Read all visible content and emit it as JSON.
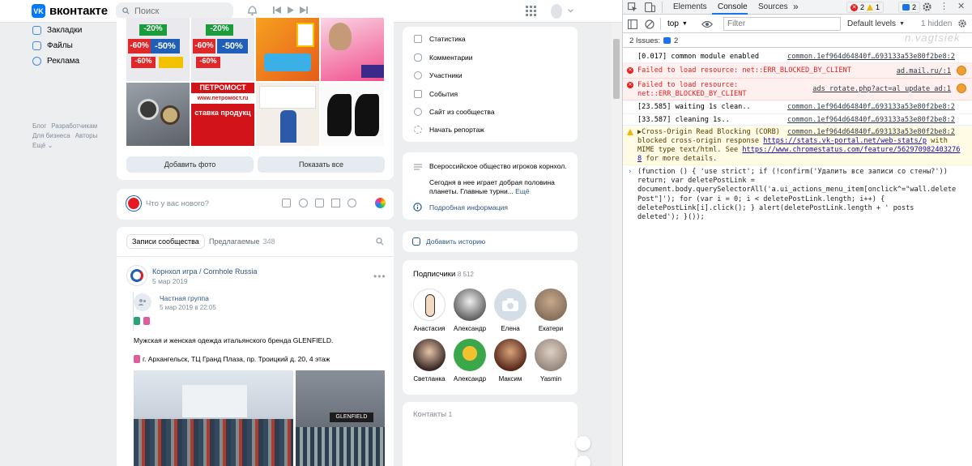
{
  "vk": {
    "logo_text": "вконтакте",
    "logo_mark": "VK",
    "search_placeholder": "Поиск",
    "nav": [
      "Закладки",
      "Файлы",
      "Реклама"
    ],
    "footer": [
      "Блог",
      "Разработчикам",
      "Для бизнеса",
      "Авторы",
      "Ещё ⌄"
    ],
    "photo_tiles": {
      "sale": [
        "-20%",
        "-50%",
        "-60%"
      ],
      "store_sign": "ПЕТРОМОСТ",
      "store_banner": "ставка продукц",
      "store_url": "www.петромост.ru"
    },
    "photo_buttons": [
      "Добавить фото",
      "Показать все"
    ],
    "composer_placeholder": "Что у вас нового?",
    "feed_tabs": {
      "active": "Записи сообщества",
      "suggested": "Предлагаемые",
      "suggested_count": "348"
    },
    "post": {
      "author": "Корнхол игра / Cornhole Russia",
      "date": "5 мар 2019",
      "repost_author": "Частная группа",
      "repost_date": "5 мар 2019 в 22:05",
      "text1": "Мужская и женская одежда итальянского бренда GLENFIELD.",
      "text2": "г. Архангельск, ТЦ Гранд Плаза, пр. Троицкий д. 20, 4 этаж",
      "shop_sign": "GLENFIELD"
    },
    "menu": [
      "Статистика",
      "Комментарии",
      "Участники",
      "События",
      "Сайт из сообщества",
      "Начать репортаж"
    ],
    "info": {
      "title": "Всероссийское общество игроков корнхол.",
      "text": "Сегодня в нее играет добрая половина планеты. Главные турни...",
      "more": "Ещё",
      "details": "Подробная информация"
    },
    "story": "Добавить историю",
    "subscribers": {
      "title": "Подписчики",
      "count": "8 512",
      "people": [
        "Анастасия",
        "Александр",
        "Елена",
        "Екатери",
        "Светланка",
        "Александр",
        "Максим",
        "Yasmin"
      ]
    },
    "contacts": {
      "title": "Контакты",
      "count": "1"
    }
  },
  "devtools": {
    "tabs": [
      "Elements",
      "Console",
      "Sources"
    ],
    "more_tabs": "»",
    "errors_count": "2",
    "warnings_count": "1",
    "issues_count_badge": "2",
    "context": "top",
    "filter_placeholder": "Filter",
    "levels": "Default levels",
    "hidden": "1 hidden",
    "issues_label": "2 Issues:",
    "issues_count": "2",
    "watermark": "n.vagtsiek",
    "logs": [
      {
        "type": "info",
        "text": "[0.017]  common module enabled",
        "src": "common.1ef964d64840f…693133a53e80f2be8:2"
      },
      {
        "type": "error",
        "text": "Failed to load resource: net::ERR_BLOCKED_BY_CLIENT",
        "src": "ad.mail.ru/:1"
      },
      {
        "type": "error",
        "text": "Failed to load resource: net::ERR_BLOCKED_BY_CLIENT",
        "src": "ads_rotate.php?act=al_update_ad:1"
      },
      {
        "type": "info",
        "text": "[23.585]  waiting 1s clean..",
        "src": "common.1ef964d64840f…693133a53e80f2be8:2"
      },
      {
        "type": "info",
        "text": "[33.587]  cleaning 1s..",
        "src": "common.1ef964d64840f…693133a53e80f2be8:2"
      }
    ],
    "corb": {
      "line1": "▶Cross-Origin Read Blocking (CORB)",
      "line2a": "blocked cross-origin response ",
      "line2b": "https://stats.vk-portal.net/web-stats/p",
      "line2c": " with",
      "line3a": "MIME type text/html. See ",
      "line3b": "https://www.chromestatus.com/feature/562970982403276",
      "line4a": "8",
      "line4b": " for more details.",
      "src": "common.1ef964d64840f…693133a53e80f2be8:2"
    },
    "command": [
      "(function () { 'use strict'; if (!confirm('Удалить все записи со стены?'))",
      "return; var deletePostLink =",
      "document.body.querySelectorAll('a.ui_actions_menu_item[onclick^=\"wall.delete",
      "Post\"]'); for (var i = 0; i < deletePostLink.length; i++) {",
      "deletePostLink[i].click(); } alert(deletePostLink.length + ' posts",
      "deleted'); }());"
    ]
  }
}
